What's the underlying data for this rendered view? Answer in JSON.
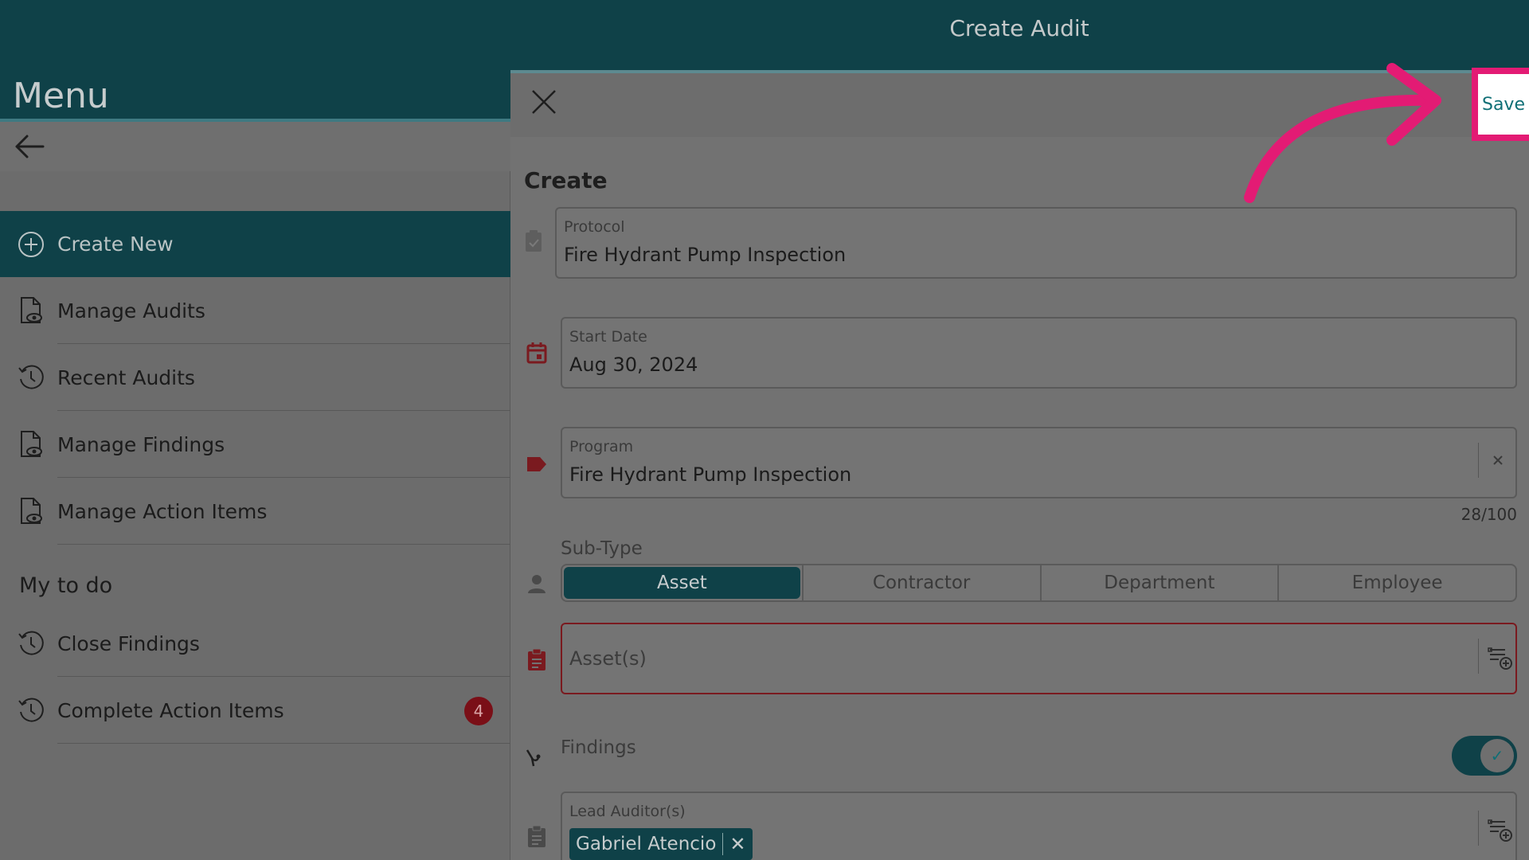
{
  "header": {
    "title": "Create Audit"
  },
  "menu": {
    "title": "Menu",
    "create_new": "Create New",
    "items": [
      {
        "label": "Manage Audits",
        "icon": "document-eye-icon"
      },
      {
        "label": "Recent Audits",
        "icon": "history-icon"
      },
      {
        "label": "Manage Findings",
        "icon": "document-eye-icon"
      },
      {
        "label": "Manage Action Items",
        "icon": "document-eye-icon"
      }
    ],
    "todo_title": "My to do",
    "todo_items": [
      {
        "label": "Close Findings",
        "icon": "history-icon"
      },
      {
        "label": "Complete Action Items",
        "icon": "history-icon",
        "badge": "4"
      }
    ]
  },
  "form": {
    "save_label": "Save",
    "heading": "Create",
    "protocol": {
      "label": "Protocol",
      "value": "Fire Hydrant Pump Inspection"
    },
    "start_date": {
      "label": "Start Date",
      "value": "Aug 30, 2024"
    },
    "program": {
      "label": "Program",
      "value": "Fire Hydrant Pump Inspection",
      "counter": "28/100"
    },
    "subtype": {
      "label": "Sub-Type",
      "options": [
        "Asset",
        "Contractor",
        "Department",
        "Employee"
      ],
      "selected": "Asset"
    },
    "assets": {
      "placeholder": "Asset(s)"
    },
    "findings": {
      "label": "Findings",
      "enabled": true
    },
    "lead_auditors": {
      "label": "Lead Auditor(s)",
      "chips": [
        "Gabriel Atencio"
      ]
    }
  },
  "colors": {
    "header_bg": "#0f4148",
    "highlight": "#e31b74",
    "badge_bg": "#7a0f17",
    "error_border": "#7a1a1f"
  }
}
